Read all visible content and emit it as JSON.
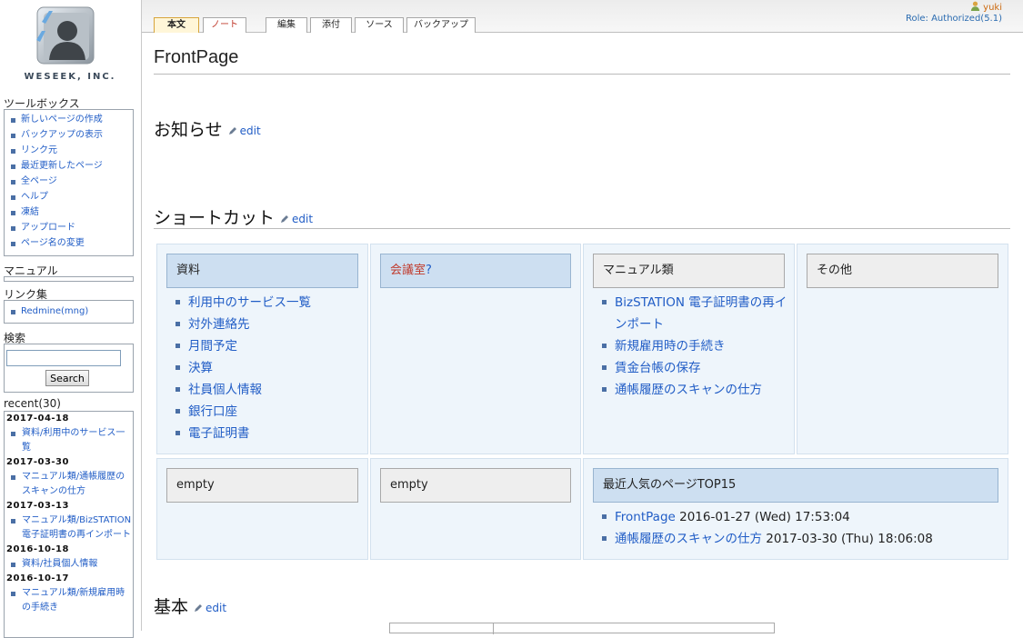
{
  "logo": {
    "text": "WESEEK, INC."
  },
  "sidebar": {
    "toolbox_title": "ツールボックス",
    "toolbox_items": [
      "新しいページの作成",
      "バックアップの表示",
      "リンク元",
      "最近更新したページ",
      "全ページ",
      "ヘルプ",
      "凍結",
      "アップロード",
      "ページ名の変更"
    ],
    "manual_title": "マニュアル",
    "links_title": "リンク集",
    "links_items": [
      "Redmine(mng)"
    ],
    "search_title": "検索",
    "search_value": "",
    "search_button": "Search",
    "recent_title": "recent(30)",
    "recent": [
      {
        "date": "2017-04-18",
        "items": [
          "資料/利用中のサービス一覧"
        ]
      },
      {
        "date": "2017-03-30",
        "items": [
          "マニュアル類/通帳履歴のスキャンの仕方"
        ]
      },
      {
        "date": "2017-03-13",
        "items": [
          "マニュアル類/BizSTATION 電子証明書の再インポート"
        ]
      },
      {
        "date": "2016-10-18",
        "items": [
          "資料/社員個人情報"
        ]
      },
      {
        "date": "2016-10-17",
        "items": [
          "マニュアル類/新規雇用時の手続き"
        ]
      }
    ]
  },
  "tabs": [
    "本文",
    "ノート",
    "編集",
    "添付",
    "ソース",
    "バックアップ"
  ],
  "user": {
    "name": "yuki",
    "role": "Role: Authorized(5.1)"
  },
  "page": {
    "title": "FrontPage",
    "edit_label": "edit",
    "section_notice": "お知らせ",
    "section_shortcut": "ショートカット",
    "section_basic": "基本"
  },
  "shortcuts": {
    "shiryo": {
      "title": "資料",
      "items": [
        "利用中のサービス一覧",
        "対外連絡先",
        "月間予定",
        "決算",
        "社員個人情報",
        "銀行口座",
        "電子証明書"
      ]
    },
    "kaigishitsu": {
      "title": "会議室",
      "suffix": "?"
    },
    "manual": {
      "title": "マニュアル類",
      "items": [
        "BizSTATION 電子証明書の再インポート",
        "新規雇用時の手続き",
        "賃金台帳の保存",
        "通帳履歴のスキャンの仕方"
      ]
    },
    "other": {
      "title": "その他"
    },
    "empty1": {
      "title": "empty"
    },
    "empty2": {
      "title": "empty"
    },
    "popular": {
      "title": "最近人気のページTOP15",
      "items": [
        {
          "link": "FrontPage",
          "meta": "2016-01-27 (Wed) 17:53:04"
        },
        {
          "link": "通帳履歴のスキャンの仕方",
          "meta": "2017-03-30 (Thu) 18:06:08"
        }
      ]
    }
  },
  "colors": {
    "link": "#215dc6",
    "header_blue": "#cddff1",
    "cell_bg": "#eef5fb",
    "wiki_missing": "#c0392b"
  }
}
